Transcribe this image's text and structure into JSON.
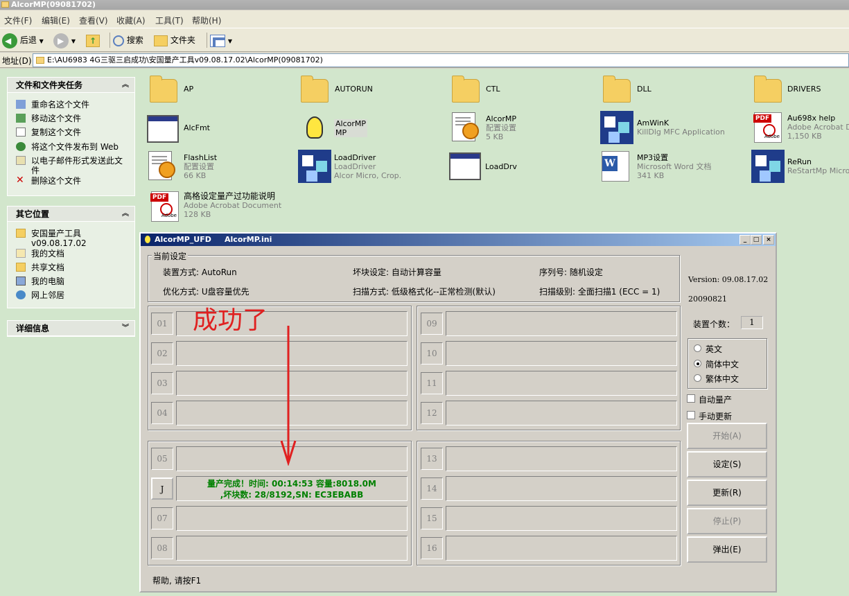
{
  "window": {
    "title": "AlcorMP(09081702)"
  },
  "menu": [
    "文件(F)",
    "编辑(E)",
    "查看(V)",
    "收藏(A)",
    "工具(T)",
    "帮助(H)"
  ],
  "toolbar": {
    "back": "后退",
    "search": "搜索",
    "folders": "文件夹"
  },
  "address": {
    "label": "地址(D)",
    "path": "E:\\AU6983 4G三驱三启成功\\安国量产工具v09.08.17.02\\AlcorMP(09081702)"
  },
  "tasks": {
    "header": "文件和文件夹任务",
    "items": [
      "重命名这个文件",
      "移动这个文件",
      "复制这个文件",
      "将这个文件发布到 Web",
      "以电子邮件形式发送此文件",
      "删除这个文件"
    ]
  },
  "places": {
    "header": "其它位置",
    "items": [
      "安国量产工具 v09.08.17.02",
      "我的文档",
      "共享文档",
      "我的电脑",
      "网上邻居"
    ]
  },
  "details": {
    "header": "详细信息"
  },
  "files": [
    {
      "name": "AP",
      "icon": "folder-icon"
    },
    {
      "name": "AUTORUN",
      "icon": "folder-icon"
    },
    {
      "name": "CTL",
      "icon": "folder-icon"
    },
    {
      "name": "DLL",
      "icon": "folder-icon"
    },
    {
      "name": "DRIVERS",
      "icon": "folder-icon"
    },
    {
      "name": "AlcFmt",
      "icon": "application-icon"
    },
    {
      "name": "AlcorMP",
      "sub1": "MP",
      "icon": "lightbulb-icon"
    },
    {
      "name": "AlcorMP",
      "sub1": "配置设置",
      "sub2": "5 KB",
      "icon": "config-icon"
    },
    {
      "name": "AmWinK",
      "sub1": "KillDlg MFC Application",
      "icon": "cube-app-icon"
    },
    {
      "name": "Au698x help",
      "sub1": "Adobe Acrobat Doc",
      "sub2": "1,150 KB",
      "icon": "pdf-icon"
    },
    {
      "name": "FlashList",
      "sub1": "配置设置",
      "sub2": "66 KB",
      "icon": "config-icon"
    },
    {
      "name": "LoadDriver",
      "sub1": "LoadDriver",
      "sub2": "Alcor Micro, Crop.",
      "icon": "cube-app-icon"
    },
    {
      "name": "LoadDrv",
      "icon": "application-icon"
    },
    {
      "name": "MP3设置",
      "sub1": "Microsoft Word 文档",
      "sub2": "341 KB",
      "icon": "word-icon"
    },
    {
      "name": "ReRun",
      "sub1": "ReStartMp Microsc",
      "icon": "cube-app-icon"
    },
    {
      "name": "高格设定量产过功能说明",
      "sub1": "Adobe Acrobat Document",
      "sub2": "128 KB",
      "icon": "pdf-icon"
    }
  ],
  "dialog": {
    "title": "AlcorMP_UFD     AlcorMP.ini",
    "group_title": "当前设定",
    "settings": {
      "device_mode": "装置方式: AutoRun",
      "bad_block": "坏块设定: 自动计算容量",
      "serial": "序列号: 随机设定",
      "optimize": "优化方式: U盘容量优先",
      "scan_mode": "扫描方式: 低级格式化--正常检测(默认)",
      "scan_level": "扫描级别: 全面扫描1 (ECC = 1)"
    },
    "version": "Version: 09.08.17.02",
    "date": "20090821",
    "device_count_label": "装置个数：",
    "device_count": "1",
    "languages": [
      {
        "label": "英文",
        "selected": false
      },
      {
        "label": "简体中文",
        "selected": true
      },
      {
        "label": "繁体中文",
        "selected": false
      }
    ],
    "checkboxes": [
      "自动量产",
      "手动更新"
    ],
    "buttons": [
      {
        "label": "开始(A)",
        "enabled": false
      },
      {
        "label": "设定(S)",
        "enabled": true
      },
      {
        "label": "更新(R)",
        "enabled": true
      },
      {
        "label": "停止(P)",
        "enabled": false
      },
      {
        "label": "弹出(E)",
        "enabled": true
      }
    ],
    "slots": [
      "01",
      "02",
      "03",
      "04",
      "05",
      "J",
      "07",
      "08",
      "09",
      "10",
      "11",
      "12",
      "13",
      "14",
      "15",
      "16"
    ],
    "slot06_message_line1": "量产完成！时间: 00:14:53 容量:8018.0M",
    "slot06_message_line2": ",坏块数: 28/8192,SN: EC3EBABB",
    "status": "帮助, 请按F1"
  },
  "annotation": "成功了",
  "colors": {
    "annotation": "#e02020",
    "success_text": "#008000",
    "titlebar": "#0a246a",
    "content_bg": "#d2e6cc"
  }
}
